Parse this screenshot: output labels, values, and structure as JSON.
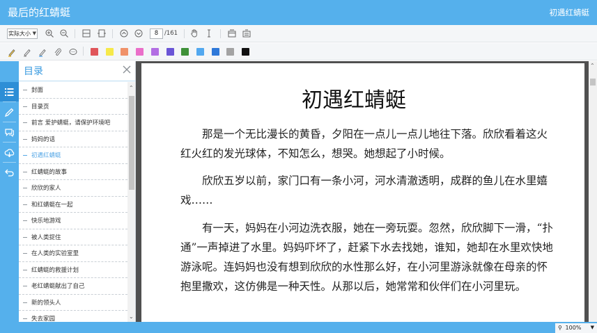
{
  "header": {
    "doc_title": "最后的红蜻蜓",
    "chapter_title": "初遇红蜻蜓"
  },
  "toolbar": {
    "zoom_value": "实际大小",
    "page_current": "8",
    "page_total": "/161",
    "icons": [
      "zoom-in-icon",
      "zoom-out-icon",
      "fit-page-icon",
      "fit-width-icon",
      "prev-page-icon",
      "next-page-icon",
      "hand-tool-icon",
      "text-select-icon",
      "fullscreen-icon",
      "settings-icon"
    ]
  },
  "annotation_tools": {
    "icons": [
      "highlighter-icon",
      "pen-icon",
      "marker-icon",
      "attach-icon",
      "comment-icon"
    ],
    "colors": [
      "#e0565b",
      "#f6e94a",
      "#f0926a",
      "#ea6fc9",
      "#b26ee3",
      "#6a55d6",
      "#3f9139",
      "#52a8ef",
      "#2f79d9",
      "#a3a3a3",
      "#111111"
    ]
  },
  "rail": {
    "icons": [
      "toc-list-icon",
      "highlight-pen-icon",
      "comments-icon",
      "cloud-icon",
      "return-icon"
    ]
  },
  "toc": {
    "title": "目录",
    "items": [
      {
        "label": "封面"
      },
      {
        "label": "目录页"
      },
      {
        "label": "前言 爱护蜻蜓，请保护环境吧"
      },
      {
        "label": "妈妈的话"
      },
      {
        "label": "初遇红蜻蜓"
      },
      {
        "label": "红蜻蜓的故事"
      },
      {
        "label": "欣欣的家人"
      },
      {
        "label": "和红蜻蜓在一起"
      },
      {
        "label": "快乐地游戏"
      },
      {
        "label": "被人类捉住"
      },
      {
        "label": "在人类的实验室里"
      },
      {
        "label": "红蜻蜓的救援计划"
      },
      {
        "label": "老红蜻蜓献出了自己"
      },
      {
        "label": "新的领头人"
      },
      {
        "label": "失去家园"
      }
    ]
  },
  "page": {
    "title": "初遇红蜻蜓",
    "paragraphs": [
      "那是一个无比漫长的黄昏，夕阳在一点儿一点儿地往下落。欣欣看着这火红火红的发光球体，不知怎么，想哭。她想起了小时候。",
      "欣欣五岁以前，家门口有一条小河，河水清澈透明，成群的鱼儿在水里嬉戏……",
      "有一天，妈妈在小河边洗衣服，她在一旁玩耍。忽然，欣欣脚下一滑，“扑通”一声掉进了水里。妈妈吓坏了，赶紧下水去找她，谁知，她却在水里欢快地游泳呢。连妈妈也没有想到欣欣的水性那么好，在小河里游泳就像在母亲的怀抱里撒欢，这仿佛是一种天性。从那以后，她常常和伙伴们在小河里玩。"
    ]
  },
  "status": {
    "zoom": "100%"
  }
}
